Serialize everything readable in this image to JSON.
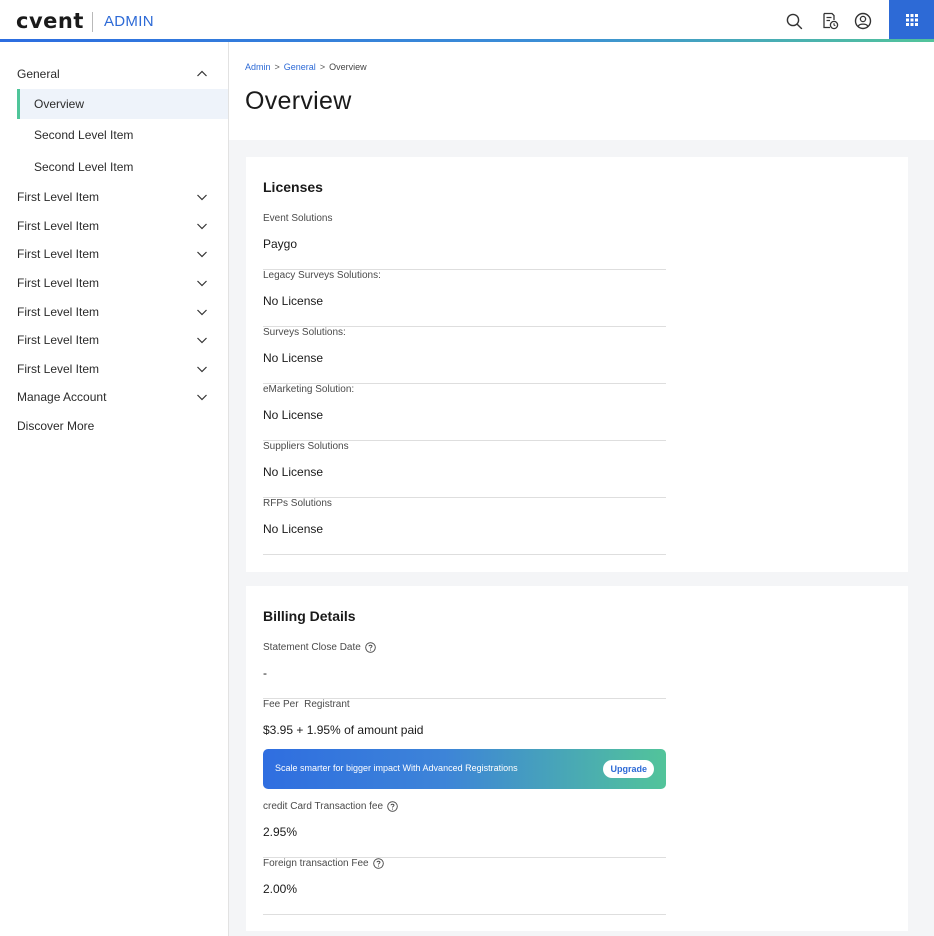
{
  "header": {
    "logo": "cvent",
    "app_name": "ADMIN",
    "icons": [
      "search-icon",
      "notes-icon",
      "user-icon",
      "apps-grid-icon"
    ]
  },
  "sidebar": {
    "general": {
      "label": "General"
    },
    "sub_items": [
      {
        "label": "Overview",
        "active": true
      },
      {
        "label": "Second Level Item"
      },
      {
        "label": "Second Level Item"
      }
    ],
    "items": [
      {
        "label": "First Level Item"
      },
      {
        "label": "First Level Item"
      },
      {
        "label": "First Level Item"
      },
      {
        "label": "First Level Item"
      },
      {
        "label": "First Level Item"
      },
      {
        "label": "First Level Item"
      },
      {
        "label": "First Level Item"
      },
      {
        "label": "Manage Account"
      }
    ],
    "discover": {
      "label": "Discover More"
    }
  },
  "breadcrumb": {
    "admin": "Admin",
    "general": "General",
    "current": "Overview"
  },
  "page": {
    "title": "Overview"
  },
  "licenses": {
    "title": "Licenses",
    "fields": [
      {
        "label": "Event Solutions",
        "value": "Paygo"
      },
      {
        "label": "Legacy Surveys Solutions:",
        "value": "No License"
      },
      {
        "label": "Surveys Solutions:",
        "value": "No License"
      },
      {
        "label": "eMarketing Solution:",
        "value": "No License"
      },
      {
        "label": "Suppliers Solutions",
        "value": "No License"
      },
      {
        "label": "RFPs Solutions",
        "value": "No License"
      }
    ]
  },
  "billing": {
    "title": "Billing Details",
    "statement": {
      "label": "Statement Close Date",
      "value": "-"
    },
    "fee": {
      "label": "Fee Per  Registrant",
      "value": "$3.95 + 1.95% of amount paid"
    },
    "promo": {
      "text": "Scale smarter for bigger impact With Advanced Registrations",
      "button": "Upgrade"
    },
    "credit": {
      "label": "credit Card Transaction fee",
      "value": "2.95%"
    },
    "foreign": {
      "label": "Foreign transaction Fee",
      "value": "2.00%"
    }
  },
  "colors": {
    "brand_blue": "#2d6ad6",
    "accent_green": "#4fc59a",
    "sidebar_active_bg": "#eef3fa"
  }
}
